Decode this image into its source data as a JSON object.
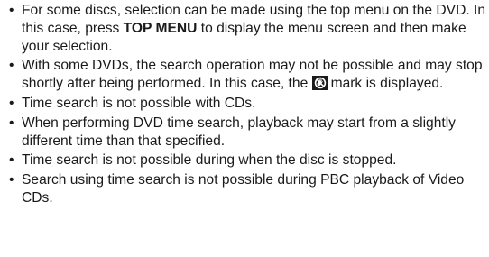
{
  "bullet_glyph": "•",
  "notes": [
    {
      "text_before": "For some discs, selection can be made using the top menu on the DVD. In this case, press ",
      "bold": "TOP MENU",
      "text_after": " to display the menu screen and then make your selection."
    },
    {
      "text_before": "With some DVDs, the search operation may not be possible and may stop shortly after being performed. In this case, the ",
      "icon": "prohibited-hand-icon",
      "text_after": "mark is displayed."
    },
    {
      "text": "Time search is not possible with CDs."
    },
    {
      "text": "When performing DVD time search, playback may start from a slightly different time than that specified."
    },
    {
      "text": "Time search is not possible during when the disc is stopped."
    },
    {
      "text": "Search using time search is not possible during PBC playback of Video CDs."
    }
  ]
}
